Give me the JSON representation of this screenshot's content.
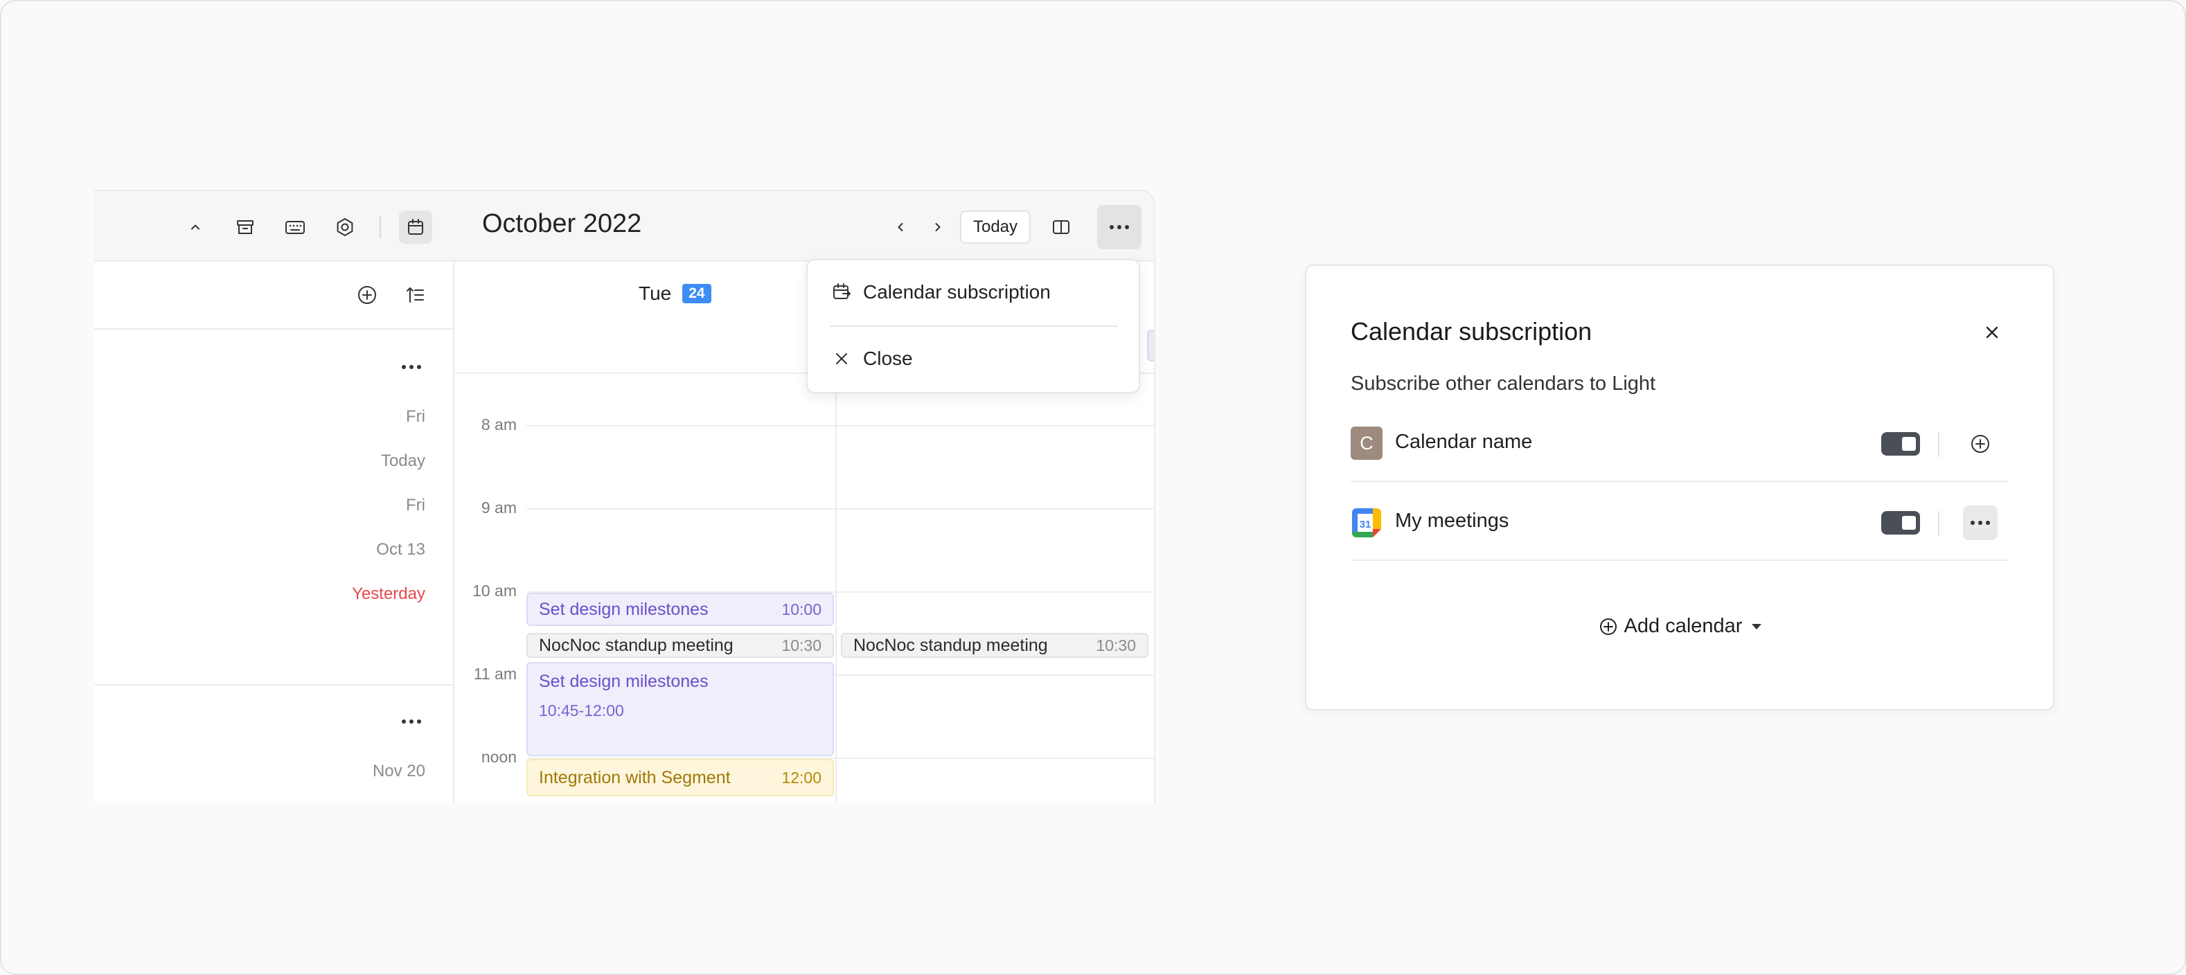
{
  "left_pane": {
    "dates": [
      "Fri",
      "Today",
      "Fri",
      "Oct 13",
      "Yesterday"
    ],
    "section2_date": "Nov 20"
  },
  "calendar": {
    "month_title": "October 2022",
    "today_button": "Today",
    "day_name": "Tue",
    "day_number": "24",
    "hours": [
      "8 am",
      "9 am",
      "10 am",
      "11 am",
      "noon"
    ],
    "events": {
      "design_milestones_1": {
        "title": "Set design milestones",
        "time": "10:00"
      },
      "standup_1": {
        "title": "NocNoc standup meeting",
        "time": "10:30"
      },
      "standup_2": {
        "title": "NocNoc standup meeting",
        "time": "10:30"
      },
      "design_milestones_2": {
        "title": "Set design milestones",
        "time": "10:45-12:00"
      },
      "segment": {
        "title": "Integration with Segment",
        "time": "12:00"
      }
    }
  },
  "dropdown": {
    "items": [
      "Calendar subscription",
      "Close"
    ]
  },
  "modal": {
    "title": "Calendar subscription",
    "subtitle": "Subscribe other calendars to Light",
    "calendars": [
      {
        "avatar": "C",
        "name": "Calendar name",
        "enabled": true,
        "action_icon": "plus-circle-icon"
      },
      {
        "avatar": "31",
        "name": "My meetings",
        "enabled": true,
        "action_icon": "more-icon"
      }
    ],
    "add_calendar": "Add calendar"
  },
  "colors": {
    "accent_blue": "#3d8df5",
    "yesterday_red": "#e5484d",
    "event_purple": "#6b4fc9",
    "event_yellow": "#a0780a",
    "switch_on": "#4a4f57"
  }
}
